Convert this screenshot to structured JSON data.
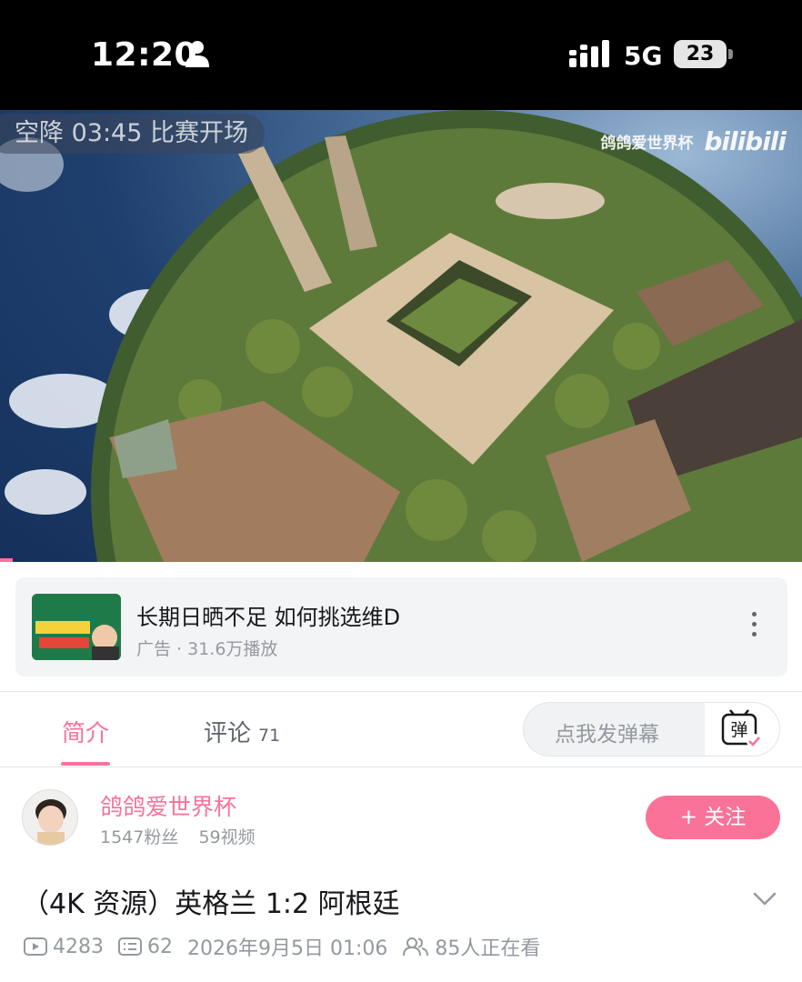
{
  "status_bar": {
    "time": "12:20",
    "network": "5G",
    "battery": "23"
  },
  "video": {
    "overlay_text": "空降 03:45 比赛开场",
    "watermark_name": "鸽鸽爱世界杯",
    "watermark_logo": "bilibili"
  },
  "ad": {
    "title": "长期日晒不足 如何挑选维D",
    "subtitle": "广告 · 31.6万播放"
  },
  "tabs": [
    {
      "label": "简介"
    },
    {
      "label": "评论",
      "count": "71"
    }
  ],
  "danmaku": {
    "placeholder": "点我发弹幕"
  },
  "uploader": {
    "name": "鸽鸽爱世界杯",
    "fans": "1547粉丝",
    "videos": "59视频",
    "follow_label": "+ 关注"
  },
  "video_title": "（4K 资源）英格兰 1:2 阿根廷",
  "meta": {
    "views": "4283",
    "danmaku_count": "62",
    "date": "2026年9月5日 01:06",
    "watching": "85人正在看"
  },
  "colors": {
    "accent": "#fb7299",
    "muted": "#9499a0",
    "text": "#18191c"
  }
}
